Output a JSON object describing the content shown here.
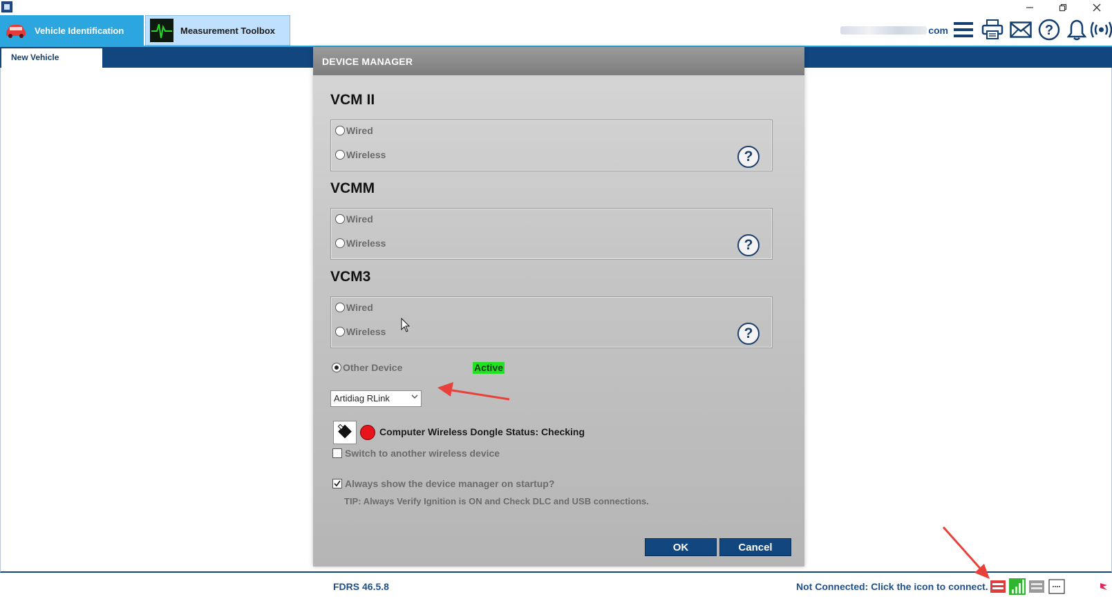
{
  "app": {
    "icon": "fdrs-app-icon",
    "window_controls": [
      "minimize-icon",
      "restore-icon",
      "close-icon"
    ]
  },
  "tabs": [
    {
      "label": "Vehicle Identification",
      "icon": "car-icon"
    },
    {
      "label": "Measurement Toolbox",
      "icon": "oscilloscope-icon"
    }
  ],
  "header": {
    "email_suffix": "com",
    "toolbar_icons": [
      "menu-icon",
      "printer-icon",
      "mail-icon",
      "help-icon",
      "bell-icon",
      "wireless-icon"
    ]
  },
  "subtab": {
    "label": "New Vehicle"
  },
  "dialog": {
    "title": "DEVICE MANAGER",
    "sections": [
      {
        "title": "VCM II",
        "options": [
          "Wired",
          "Wireless"
        ],
        "help": "?"
      },
      {
        "title": "VCMM",
        "options": [
          "Wired",
          "Wireless"
        ],
        "help": "?"
      },
      {
        "title": "VCM3",
        "options": [
          "Wired",
          "Wireless"
        ],
        "help": "?"
      }
    ],
    "other_device": {
      "label": "Other Device",
      "selected": true,
      "badge": "Active",
      "badge_color": "#22e022"
    },
    "device_select": {
      "value": "Artidiag RLink"
    },
    "dongle": {
      "label": "Computer Wireless Dongle",
      "status": "Status: Checking",
      "status_color": "#e8141b"
    },
    "switch_device": {
      "label": "Switch to another wireless device",
      "checked": false
    },
    "startup": {
      "label": "Always show the device manager on startup?",
      "checked": true
    },
    "tip": "TIP: Always Verify Ignition is ON and Check DLC and USB connections.",
    "ok_label": "OK",
    "cancel_label": "Cancel"
  },
  "statusbar": {
    "version": "FDRS 46.5.8",
    "connection_text": "Not Connected: Click the icon to connect.",
    "icons": [
      "vci-connect-icon",
      "signal-bars-icon",
      "device-status-icon",
      "more-icon",
      "flag-icon"
    ]
  },
  "colors": {
    "nav_blue": "#12467f",
    "tab_blue": "#2ba6df",
    "arrow_red": "#e8413b"
  }
}
